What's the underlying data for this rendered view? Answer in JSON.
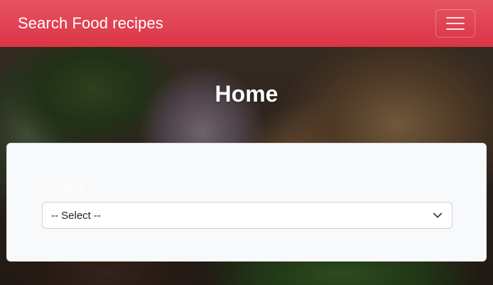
{
  "navbar": {
    "brand": "Search Food recipes",
    "menu_icon": "hamburger-menu-icon"
  },
  "hero": {
    "title": "Home"
  },
  "form": {
    "category_label": "Categoria",
    "category_select": {
      "selected": "-- Select --",
      "icon": "chevron-down-icon"
    }
  },
  "colors": {
    "navbar_accent": "#dc3545",
    "card_background": "#f8f9fa"
  }
}
